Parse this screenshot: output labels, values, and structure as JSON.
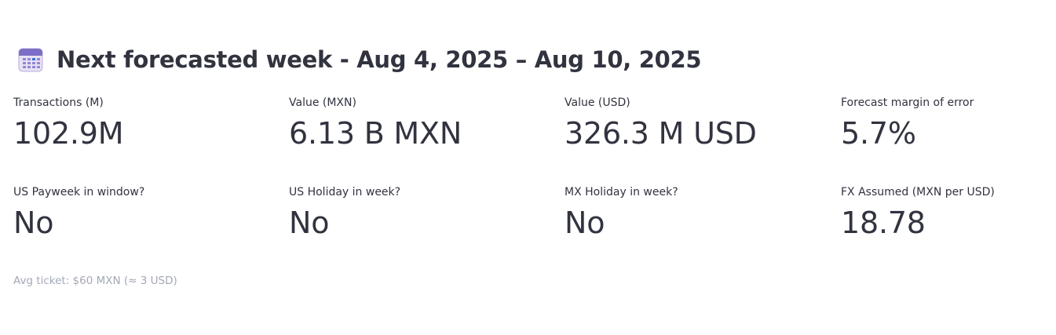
{
  "header": {
    "icon": "calendar-icon",
    "title": "Next forecasted week - Aug 4, 2025 – Aug 10, 2025"
  },
  "metrics": [
    {
      "label": "Transactions (M)",
      "value": "102.9M"
    },
    {
      "label": "Value (MXN)",
      "value": "6.13 B MXN"
    },
    {
      "label": "Value (USD)",
      "value": "326.3 M USD"
    },
    {
      "label": "Forecast margin of error",
      "value": "5.7%"
    },
    {
      "label": "US Payweek in window?",
      "value": "No"
    },
    {
      "label": "US Holiday in week?",
      "value": "No"
    },
    {
      "label": "MX Holiday in week?",
      "value": "No"
    },
    {
      "label": "FX Assumed (MXN per USD)",
      "value": "18.78"
    }
  ],
  "caption": "Avg ticket: $60 MXN (≈ 3 USD)",
  "colors": {
    "text": "#31333f",
    "caption": "#a3a8b8",
    "background": "#ffffff"
  }
}
